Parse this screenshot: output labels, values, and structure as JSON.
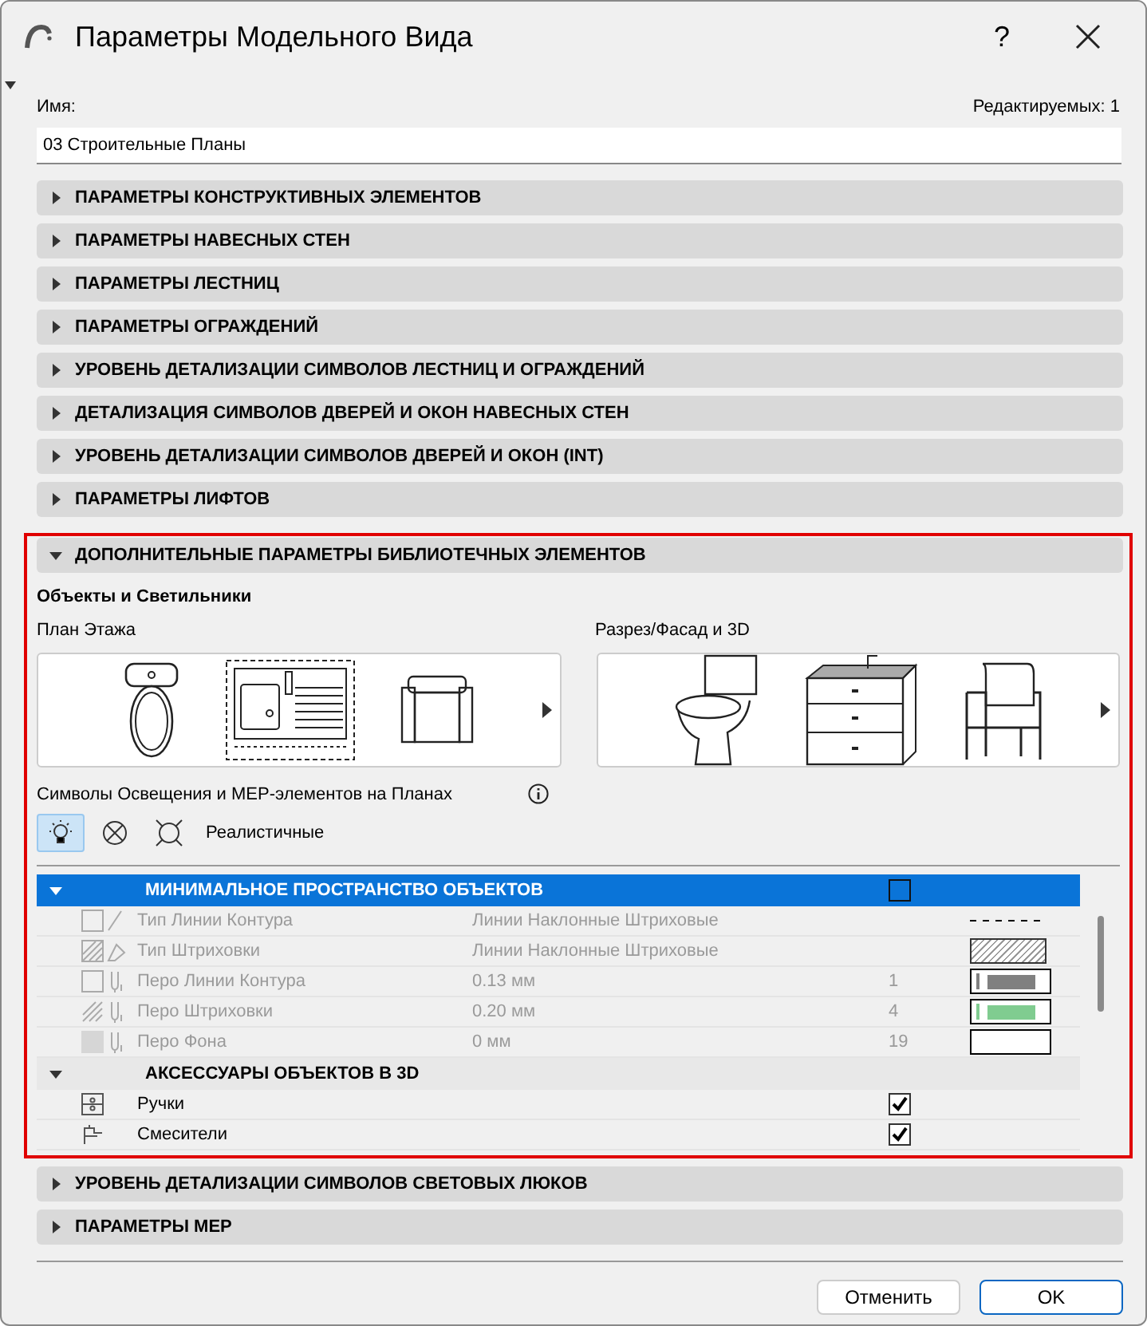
{
  "window": {
    "title": "Параметры Модельного Вида",
    "help_label": "?"
  },
  "name_label": "Имя:",
  "editable_count": "Редактируемых: 1",
  "name_value": "03 Строительные Планы",
  "sections": [
    {
      "title": "ПАРАМЕТРЫ КОНСТРУКТИВНЫХ ЭЛЕМЕНТОВ",
      "expanded": false
    },
    {
      "title": "ПАРАМЕТРЫ НАВЕСНЫХ СТЕН",
      "expanded": false
    },
    {
      "title": "ПАРАМЕТРЫ ЛЕСТНИЦ",
      "expanded": false
    },
    {
      "title": "ПАРАМЕТРЫ ОГРАЖДЕНИЙ",
      "expanded": false
    },
    {
      "title": "УРОВЕНЬ ДЕТАЛИЗАЦИИ СИМВОЛОВ ЛЕСТНИЦ И ОГРАЖДЕНИЙ",
      "expanded": false
    },
    {
      "title": "ДЕТАЛИЗАЦИЯ СИМВОЛОВ ДВЕРЕЙ И ОКОН НАВЕСНЫХ СТЕН",
      "expanded": false
    },
    {
      "title": "УРОВЕНЬ ДЕТАЛИЗАЦИИ СИМВОЛОВ ДВЕРЕЙ И ОКОН (INT)",
      "expanded": false
    },
    {
      "title": "ПАРАМЕТРЫ ЛИФТОВ",
      "expanded": false
    },
    {
      "title": "ДОПОЛНИТЕЛЬНЫЕ ПАРАМЕТРЫ БИБЛИОТЕЧНЫХ ЭЛЕМЕНТОВ",
      "expanded": true
    },
    {
      "title": "УРОВЕНЬ ДЕТАЛИЗАЦИИ СИМВОЛОВ СВЕТОВЫХ ЛЮКОВ",
      "expanded": false
    },
    {
      "title": "ПАРАМЕТРЫ МЕР",
      "expanded": false
    }
  ],
  "library": {
    "subtitle": "Объекты и Светильники",
    "floor_plan_label": "План Этажа",
    "section_label": "Разрез/Фасад и 3D",
    "mep_label": "Символы Освещения и МЕР-элементов на Планах",
    "symbol_options": [
      {
        "kind": "bulb",
        "selected": true
      },
      {
        "kind": "cross",
        "selected": false
      },
      {
        "kind": "realistic",
        "selected": false
      }
    ],
    "symbol_caption": "Реалистичные",
    "groups": [
      {
        "title": "МИНИМАЛЬНОЕ ПРОСТРАНСТВО ОБЪЕКТОВ",
        "expanded": true,
        "selected": true,
        "checked": false,
        "rows": [
          {
            "kind": "line-type",
            "label": "Тип Линии Контура",
            "value": "Линии Наклонные Штриховые",
            "disabled": true
          },
          {
            "kind": "fill-type",
            "label": "Тип Штриховки",
            "value": "Линии Наклонные Штриховые",
            "disabled": true
          },
          {
            "kind": "pen-line",
            "label": "Перо Линии Контура",
            "value": "0.13 мм",
            "number": "1",
            "color": "#808080",
            "disabled": true
          },
          {
            "kind": "pen-fill",
            "label": "Перо Штриховки",
            "value": "0.20 мм",
            "number": "4",
            "color": "#80cc90",
            "disabled": true
          },
          {
            "kind": "pen-background",
            "label": "Перо Фона",
            "value": "0 мм",
            "number": "19",
            "disabled": true
          }
        ]
      },
      {
        "title": "АКСЕССУАРЫ ОБЪЕКТОВ В 3D",
        "expanded": true,
        "selected": false,
        "rows": [
          {
            "kind": "handles",
            "label": "Ручки",
            "checked": true,
            "disabled": false
          },
          {
            "kind": "faucet",
            "label": "Смесители",
            "checked": true,
            "disabled": false
          }
        ]
      }
    ]
  },
  "buttons": [
    {
      "label": "Отменить",
      "default": false
    },
    {
      "label": "OK",
      "default": true
    }
  ]
}
